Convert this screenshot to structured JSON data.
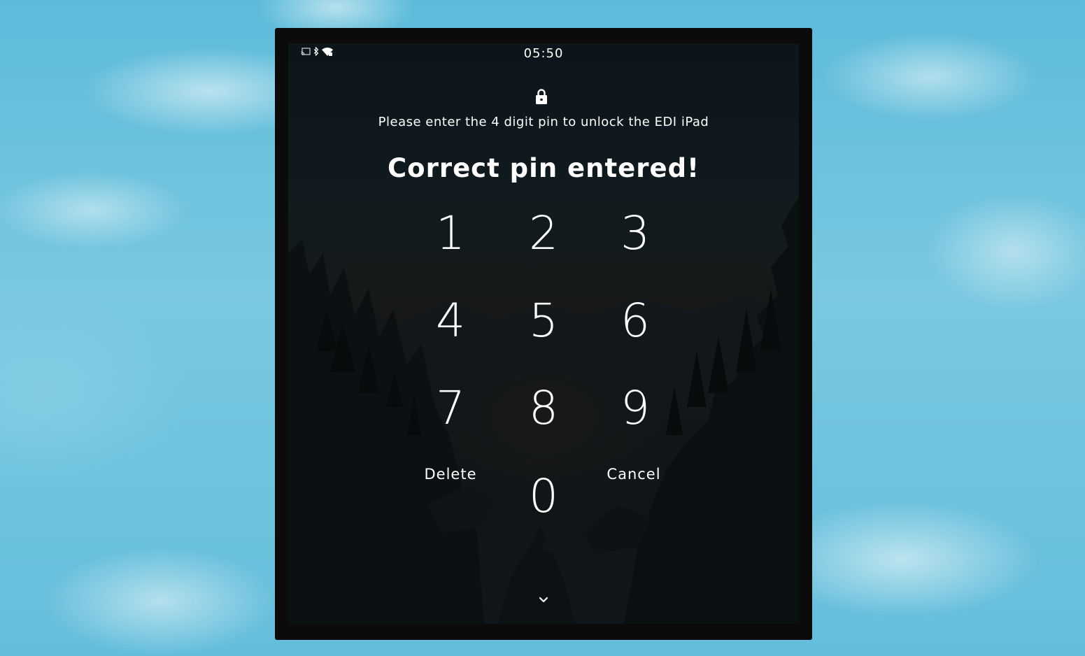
{
  "status_bar": {
    "time": "05:50",
    "icons": [
      "cast-icon",
      "bluetooth-icon",
      "wifi-icon"
    ]
  },
  "lock_screen": {
    "lock_icon": "lock-icon",
    "prompt": "Please enter the 4 digit pin to unlock the EDI iPad",
    "status_message": "Correct pin entered!",
    "keypad": {
      "keys": [
        "1",
        "2",
        "3",
        "4",
        "5",
        "6",
        "7",
        "8",
        "9",
        "0"
      ],
      "delete_label": "Delete",
      "cancel_label": "Cancel"
    },
    "expand_icon": "chevron-down-icon"
  },
  "colors": {
    "text": "#ffffff",
    "tablet_frame": "#0b0b0b",
    "sky": "#6cc3dd"
  }
}
